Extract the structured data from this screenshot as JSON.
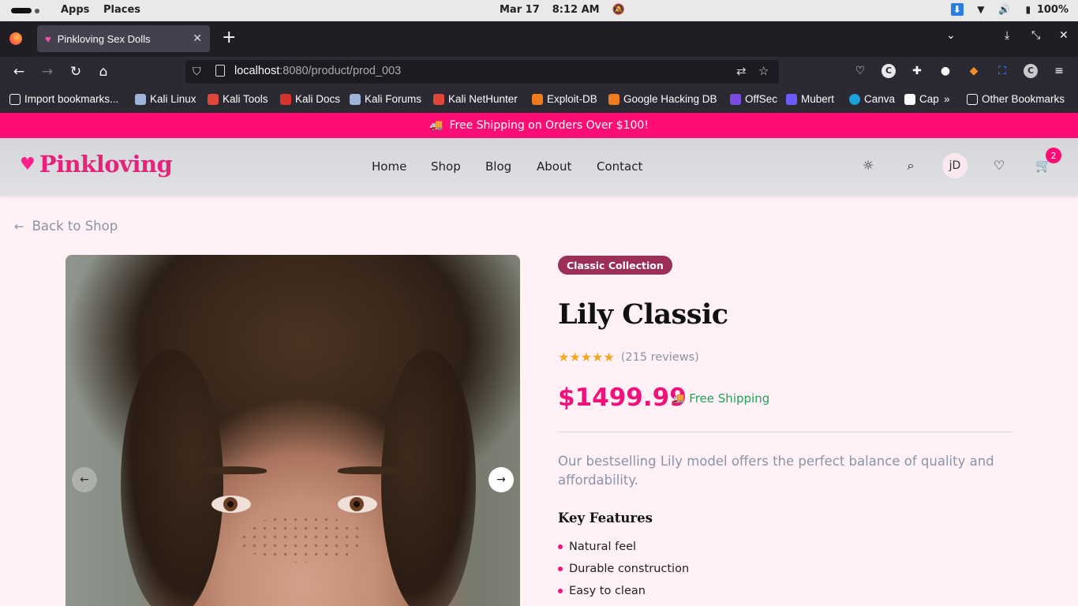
{
  "os": {
    "menu": [
      "Apps",
      "Places"
    ],
    "date": "Mar 17",
    "time": "8:12 AM",
    "battery": "100%"
  },
  "browser": {
    "tab_title": "Pinkloving Sex Dolls",
    "url_host": "localhost",
    "url_path": ":8080/product/prod_003",
    "bookmarks": [
      {
        "label": "Import bookmarks...",
        "color": "#fbfbfe"
      },
      {
        "label": "Kali Linux",
        "color": "#9fb4d8"
      },
      {
        "label": "Kali Tools",
        "color": "#e0463a"
      },
      {
        "label": "Kali Docs",
        "color": "#d8322c"
      },
      {
        "label": "Kali Forums",
        "color": "#9fb4d8"
      },
      {
        "label": "Kali NetHunter",
        "color": "#e0463a"
      },
      {
        "label": "Exploit-DB",
        "color": "#f07b1c"
      },
      {
        "label": "Google Hacking DB",
        "color": "#f07b1c"
      },
      {
        "label": "OffSec",
        "color": "#7a4de0"
      },
      {
        "label": "Mubert",
        "color": "#6a5cff"
      },
      {
        "label": "Canva",
        "color": "#1aa3d8"
      },
      {
        "label": "Cap",
        "color": "#fbfbfe"
      },
      {
        "label": "Other Bookmarks",
        "color": "#fbfbfe"
      }
    ]
  },
  "site": {
    "promo": "Free Shipping on Orders Over $100!",
    "brand": "Pinkloving",
    "nav": [
      "Home",
      "Shop",
      "Blog",
      "About",
      "Contact"
    ],
    "avatar_initials": "jD",
    "cart_count": "2",
    "accent": "#ff0c74"
  },
  "product": {
    "back_label": "Back to Shop",
    "collection": "Classic Collection",
    "title": "Lily Classic",
    "stars": "★★★★★",
    "reviews": "(215 reviews)",
    "price": "$1499.99",
    "shipping": "Free Shipping",
    "description": "Our bestselling Lily model offers the perfect balance of quality and affordability.",
    "features_title": "Key Features",
    "features": [
      "Natural feel",
      "Durable construction",
      "Easy to clean"
    ]
  }
}
